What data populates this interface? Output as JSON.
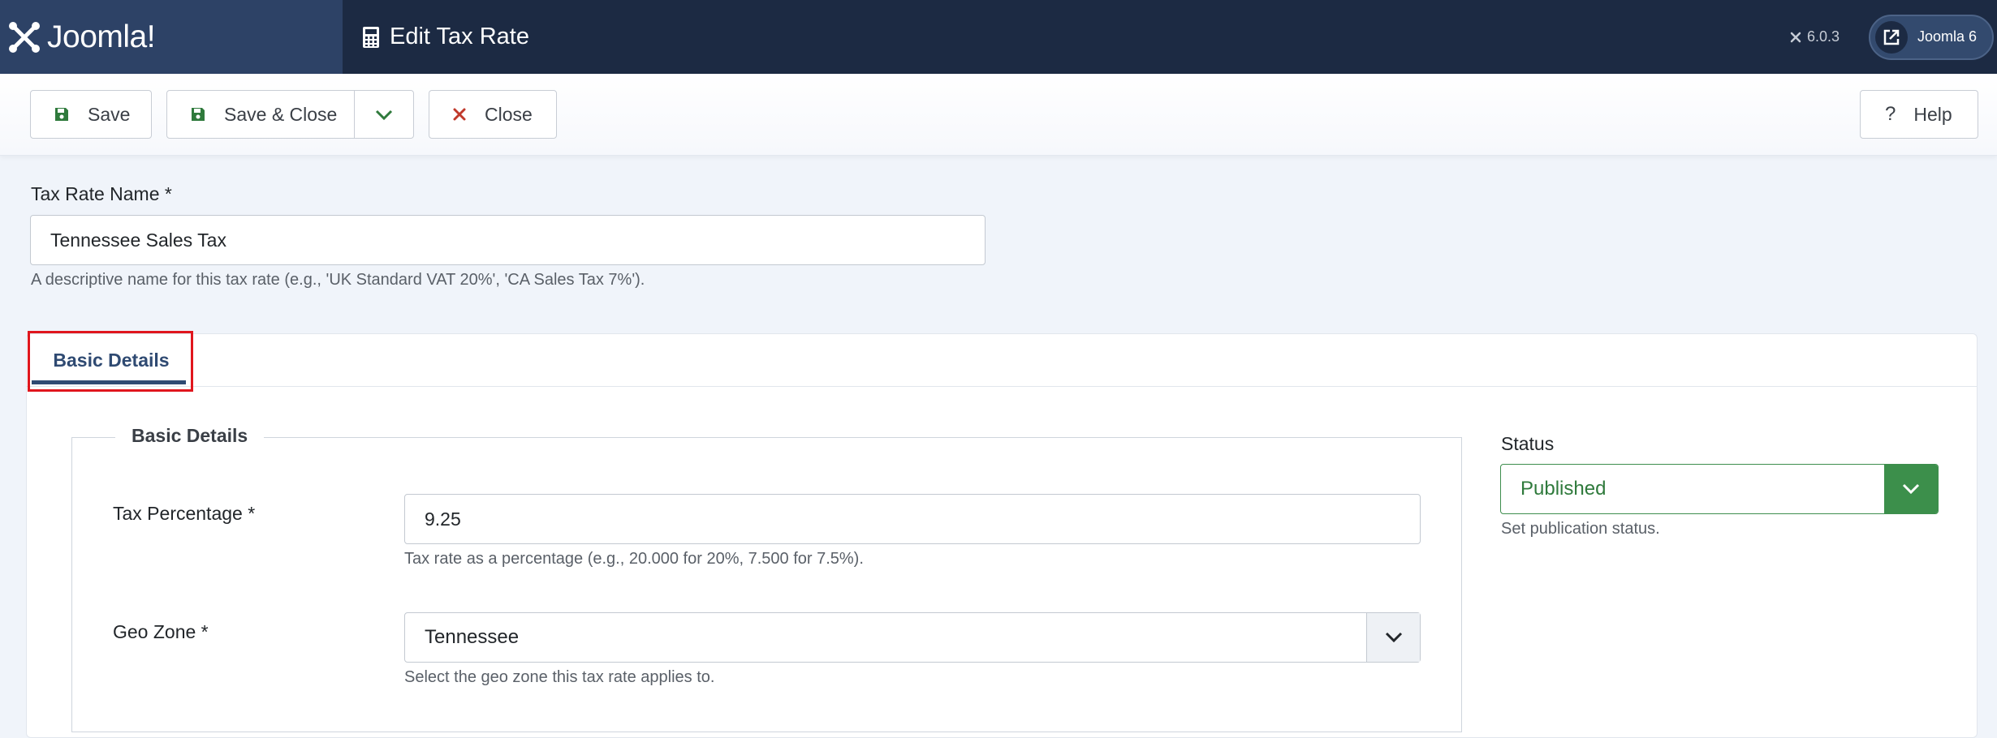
{
  "header": {
    "brand": "Joomla!",
    "page_title": "Edit Tax Rate",
    "version": "6.0.3",
    "site_link": "Joomla 6",
    "colors": {
      "header_bg": "#1c2a43",
      "logo_bg": "#2d4266"
    },
    "icons": {
      "brand": "joomla-logo",
      "title": "calculator-icon",
      "site": "external-link-icon"
    }
  },
  "toolbar": {
    "save_label": "Save",
    "save_close_label": "Save & Close",
    "close_label": "Close",
    "help_label": "Help",
    "icons": {
      "save": "floppy-disk-icon",
      "dropdown": "chevron-down-icon",
      "close": "x-icon",
      "help": "question-icon"
    }
  },
  "form": {
    "name_label": "Tax Rate Name *",
    "name_value": "Tennessee Sales Tax",
    "name_help": "A descriptive name for this tax rate (e.g., 'UK Standard VAT 20%', 'CA Sales Tax 7%').",
    "tabs": [
      {
        "label": "Basic Details",
        "active": true
      }
    ],
    "fieldset_legend": "Basic Details",
    "tax_percentage_label": "Tax Percentage *",
    "tax_percentage_value": "9.25",
    "tax_percentage_help": "Tax rate as a percentage (e.g., 20.000 for 20%, 7.500 for 7.5%).",
    "geo_zone_label": "Geo Zone *",
    "geo_zone_value": "Tennessee",
    "geo_zone_help": "Select the geo zone this tax rate applies to.",
    "status_label": "Status",
    "status_value": "Published",
    "status_help": "Set publication status.",
    "colors": {
      "status_green": "#3c8f4b",
      "tab_accent": "#2f4a72",
      "highlight_box": "#e0161d"
    }
  }
}
